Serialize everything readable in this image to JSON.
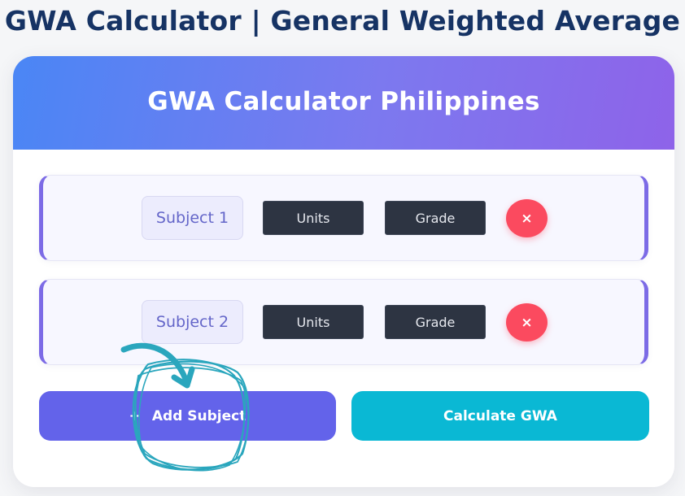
{
  "page_title": "GWA Calculator | General Weighted Average",
  "card": {
    "title": "GWA Calculator Philippines"
  },
  "subjects": [
    {
      "name": "Subject 1",
      "units_label": "Units",
      "grade_label": "Grade",
      "remove_label": "×"
    },
    {
      "name": "Subject 2",
      "units_label": "Units",
      "grade_label": "Grade",
      "remove_label": "×"
    }
  ],
  "actions": {
    "add_subject_icon": "+",
    "add_subject_label": "Add Subject",
    "calculate_label": "Calculate GWA"
  },
  "colors": {
    "title": "#163364",
    "header_gradient_start": "#4a86f5",
    "header_gradient_end": "#8e63e9",
    "add_button": "#6363ea",
    "calculate_button": "#0ab8d4",
    "remove_button": "#fb4a5f",
    "annotation": "#2aa6bd"
  },
  "icons": {
    "remove": "close-icon",
    "add": "plus-icon",
    "annotation_arrow": "arrow-annotation-icon",
    "annotation_circle": "scribble-circle-icon"
  }
}
